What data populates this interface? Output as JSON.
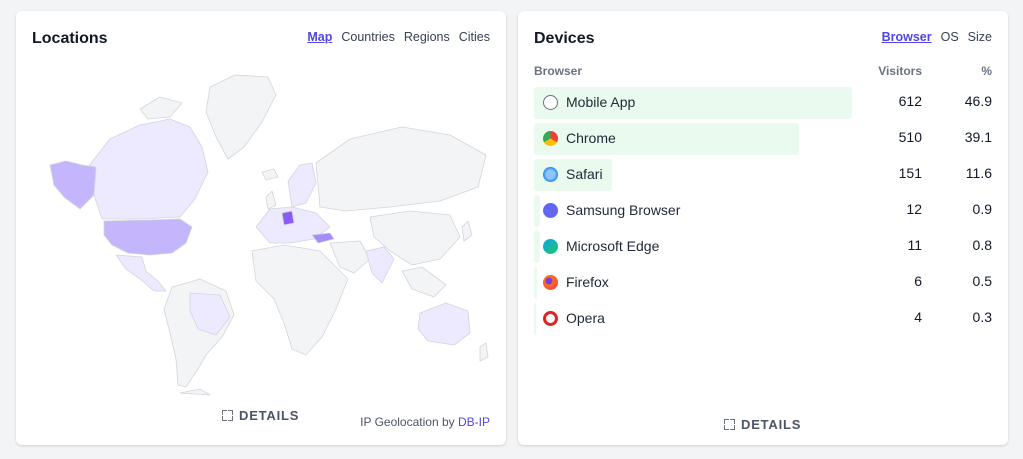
{
  "locations": {
    "title": "Locations",
    "tabs": [
      "Map",
      "Countries",
      "Regions",
      "Cities"
    ],
    "active_tab": "Map",
    "details_label": "DETAILS",
    "attribution_prefix": "IP Geolocation by",
    "attribution_link": "DB-IP",
    "colors": {
      "empty": "#f3f4f6",
      "light": "#ede9fe",
      "mid": "#c4b5fd",
      "strong": "#a78bfa",
      "strongest": "#8b5cf6",
      "border": "#d1d5db"
    }
  },
  "devices": {
    "title": "Devices",
    "tabs": [
      "Browser",
      "OS",
      "Size"
    ],
    "active_tab": "Browser",
    "columns": {
      "name": "Browser",
      "visitors": "Visitors",
      "percent": "%"
    },
    "details_label": "DETAILS",
    "bar_color": "#ebfaee",
    "rows": [
      {
        "name": "Mobile App",
        "visitors": "612",
        "percent": "46.9",
        "icon": "globe-icon"
      },
      {
        "name": "Chrome",
        "visitors": "510",
        "percent": "39.1",
        "icon": "chrome-icon"
      },
      {
        "name": "Safari",
        "visitors": "151",
        "percent": "11.6",
        "icon": "safari-icon"
      },
      {
        "name": "Samsung Browser",
        "visitors": "12",
        "percent": "0.9",
        "icon": "samsung-browser-icon"
      },
      {
        "name": "Microsoft Edge",
        "visitors": "11",
        "percent": "0.8",
        "icon": "edge-icon"
      },
      {
        "name": "Firefox",
        "visitors": "6",
        "percent": "0.5",
        "icon": "firefox-icon"
      },
      {
        "name": "Opera",
        "visitors": "4",
        "percent": "0.3",
        "icon": "opera-icon"
      }
    ]
  }
}
